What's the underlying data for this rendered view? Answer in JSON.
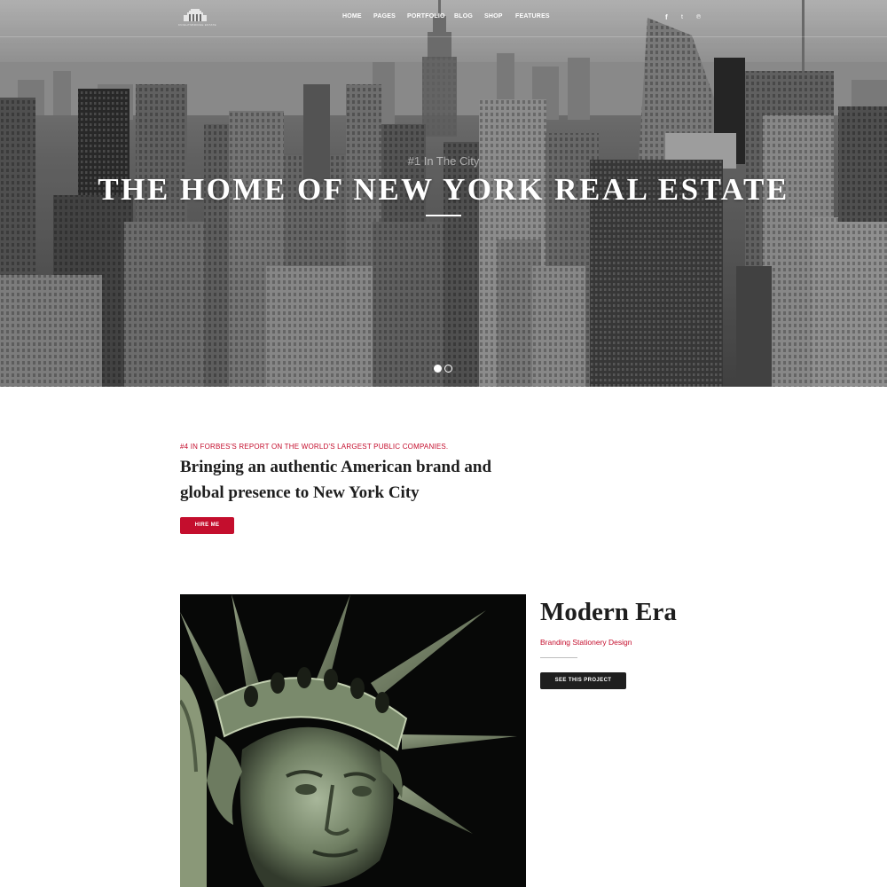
{
  "logo": {
    "caption": "KNIGHTSBRIDGE ESTATE"
  },
  "nav": {
    "items": [
      {
        "label": "HOME"
      },
      {
        "label": "PAGES"
      },
      {
        "label": "PORTFOLIO"
      },
      {
        "label": "BLOG"
      },
      {
        "label": "SHOP"
      },
      {
        "label": "FEATURES"
      }
    ]
  },
  "social": {
    "icons": [
      {
        "name": "facebook-icon",
        "glyph": "f"
      },
      {
        "name": "twitter-icon",
        "glyph": "t"
      },
      {
        "name": "pinterest-icon",
        "glyph": "℗"
      }
    ]
  },
  "hero": {
    "kicker": "#1 In The City",
    "title": "THE HOME OF NEW YORK REAL ESTATE",
    "slider": {
      "slide_count": 2,
      "active_slide": 1
    }
  },
  "intro": {
    "kicker": "#4 IN FORBES'S REPORT ON THE WORLD'S LARGEST PUBLIC COMPANIES.",
    "heading_line1": "Bringing an authentic American brand and",
    "heading_line2": "global presence to New York City",
    "button_label": "HIRE ME"
  },
  "project": {
    "title": "Modern Era",
    "subtitle": "Branding Stationery Design",
    "button_label": "SEE THIS PROJECT"
  },
  "colors": {
    "accent": "#c40e2d",
    "dark_button": "#1f1f1f",
    "heading": "#1e1e1e"
  }
}
